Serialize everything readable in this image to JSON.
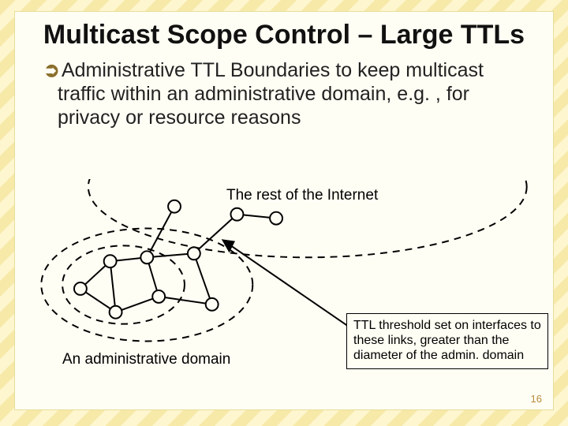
{
  "title": "Multicast Scope Control – Large TTLs",
  "bullet": {
    "text": "Administrative TTL Boundaries to keep multicast traffic within an administrative domain, e.g. , for privacy or resource reasons"
  },
  "diagram": {
    "rest_label": "The rest of the Internet",
    "admin_label": "An administrative domain",
    "ttl_box": "TTL threshold set on interfaces to these links, greater than the diameter of the admin. domain"
  },
  "page_number": "16"
}
